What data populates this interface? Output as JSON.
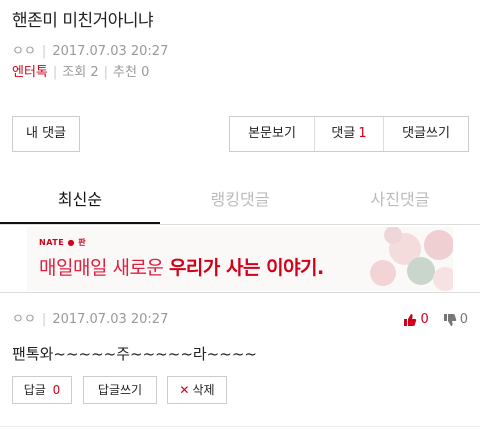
{
  "post": {
    "title": "핸존미 미친거아니냐",
    "author": "ㅇㅇ",
    "datetime": "2017.07.03 20:27",
    "category": "엔터톡",
    "views_label": "조회",
    "views": "2",
    "recommend_label": "추천",
    "recommend": "0"
  },
  "buttons": {
    "my_comments": "내 댓글",
    "view_body": "본문보기",
    "comments_label": "댓글",
    "comments_count": "1",
    "write_comment": "댓글쓰기"
  },
  "tabs": [
    {
      "label": "최신순",
      "active": true
    },
    {
      "label": "랭킹댓글",
      "active": false
    },
    {
      "label": "사진댓글",
      "active": false
    }
  ],
  "banner": {
    "brand": "NATE ● 판",
    "message_prefix": "매일매일 새로운",
    "message_highlight": "우리가 사는 이야기."
  },
  "comment": {
    "author": "ㅇㅇ",
    "datetime": "2017.07.03 20:27",
    "body": "팬톡와~~~~~주~~~~~라~~~~",
    "upvotes": "0",
    "downvotes": "0",
    "reply_label": "답글",
    "reply_count": "0",
    "write_reply": "답글쓰기",
    "delete_label": "삭제"
  },
  "colors": {
    "accent": "#d0021b",
    "muted": "#999999",
    "border": "#cccccc"
  }
}
